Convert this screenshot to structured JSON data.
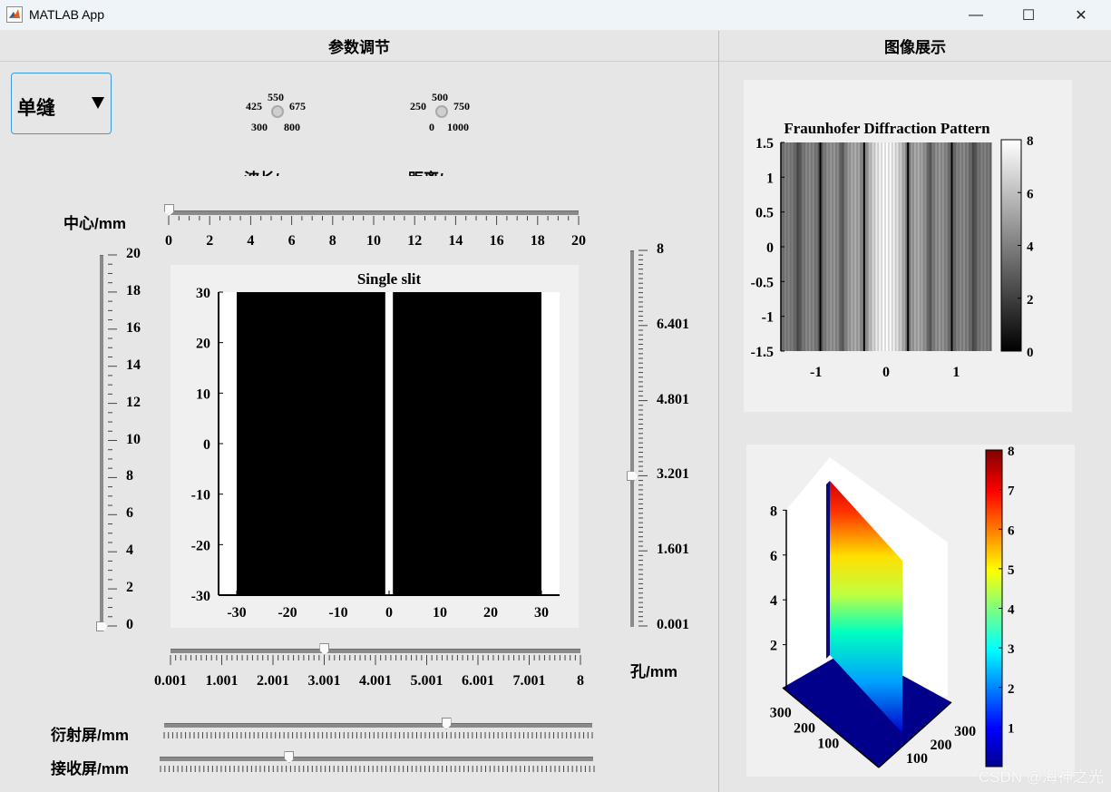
{
  "window": {
    "title": "MATLAB App",
    "minimize": "—",
    "maximize": "☐",
    "close": "✕"
  },
  "left_panel": {
    "header": "参数调节",
    "mode_dropdown": {
      "selected": "单缝"
    },
    "wavelength_knob": {
      "ticks": [
        "550",
        "425",
        "675",
        "300",
        "800"
      ],
      "label": "波长/nm"
    },
    "distance_knob": {
      "ticks": [
        "500",
        "250",
        "750",
        "0",
        "1000"
      ],
      "label": "距离/mm"
    },
    "center_slider": {
      "label": "中心/mm",
      "ticks": [
        "0",
        "2",
        "4",
        "6",
        "8",
        "10",
        "12",
        "14",
        "16",
        "18",
        "20"
      ],
      "value": 0,
      "min": 0,
      "max": 20
    },
    "left_v_slider": {
      "ticks": [
        "20",
        "18",
        "16",
        "14",
        "12",
        "10",
        "8",
        "6",
        "4",
        "2",
        "0"
      ],
      "value": 0,
      "min": 0,
      "max": 20
    },
    "right_v_slider": {
      "ticks": [
        "8",
        "6.401",
        "4.801",
        "3.201",
        "1.601",
        "0.001"
      ],
      "value": 3.2,
      "min": 0.001,
      "max": 8
    },
    "bottom_slider": {
      "ticks": [
        "0.001",
        "1.001",
        "2.001",
        "3.001",
        "4.001",
        "5.001",
        "6.001",
        "7.001",
        "8"
      ],
      "value": 3.0,
      "min": 0.001,
      "max": 8
    },
    "hole_label": "孔/mm",
    "diffraction_screen": {
      "label": "衍射屏/mm",
      "value": 0.66
    },
    "receiving_screen": {
      "label": "接收屏/mm",
      "value": 0.3
    }
  },
  "right_panel": {
    "header": "图像展示"
  },
  "chart_data": [
    {
      "type": "heatmap",
      "title": "Single slit",
      "xlim": [
        -30,
        30
      ],
      "ylim": [
        -30,
        30
      ],
      "xticks": [
        "-30",
        "-20",
        "-10",
        "0",
        "10",
        "20",
        "30"
      ],
      "yticks": [
        "30",
        "20",
        "10",
        "0",
        "-10",
        "-20",
        "-30"
      ],
      "slit_center": 0,
      "slit_width": 1.5,
      "colormap": "black/white"
    },
    {
      "type": "heatmap",
      "title": "Fraunhofer Diffraction Pattern",
      "xlim": [
        -1.5,
        1.5
      ],
      "ylim": [
        -1.5,
        1.5
      ],
      "xticks": [
        "-1",
        "0",
        "1"
      ],
      "yticks": [
        "1.5",
        "1",
        "0.5",
        "0",
        "-0.5",
        "-1",
        "-1.5"
      ],
      "colorbar": {
        "ticks": [
          "8",
          "6",
          "4",
          "2",
          "0"
        ],
        "range": [
          0,
          8
        ]
      },
      "colormap": "gray"
    },
    {
      "type": "surface",
      "zticks": [
        "8",
        "6",
        "4",
        "2"
      ],
      "xticks": [
        "300",
        "200",
        "100"
      ],
      "yticks": [
        "100",
        "200",
        "300"
      ],
      "colorbar": {
        "ticks": [
          "8",
          "7",
          "6",
          "5",
          "4",
          "3",
          "2",
          "1"
        ],
        "range": [
          0,
          8
        ]
      },
      "colormap": "jet"
    }
  ],
  "watermark": "CSDN @海神之光"
}
